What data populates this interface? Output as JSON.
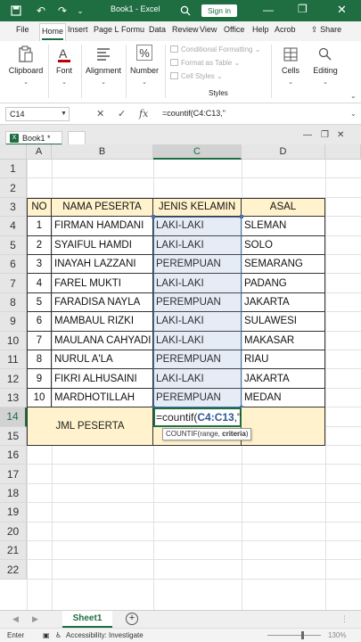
{
  "titlebar": {
    "title": "Book1 - Excel",
    "signin": "Sign in",
    "icons": [
      "save-icon",
      "undo-icon",
      "redo-icon",
      "customize-arrow-icon",
      "search-icon",
      "minimize-icon",
      "restore-icon",
      "close-icon"
    ],
    "bg_color": "#1e6e42"
  },
  "tabs": {
    "items": [
      "File",
      "Home",
      "Insert",
      "Page L",
      "Formu",
      "Data",
      "Review",
      "View",
      "Office",
      "Help",
      "Acrob"
    ],
    "active": "Home",
    "share": "Share"
  },
  "ribbon": {
    "groups": [
      {
        "label": "Clipboard",
        "icon": "clipboard-icon"
      },
      {
        "label": "Font",
        "icon": "font-icon"
      },
      {
        "label": "Alignment",
        "icon": "alignment-icon"
      },
      {
        "label": "Number",
        "icon": "percent-icon"
      },
      {
        "label": "Cells",
        "icon": "cells-icon"
      },
      {
        "label": "Editing",
        "icon": "editing-icon"
      }
    ],
    "styles": {
      "conditional": "Conditional Formatting",
      "table": "Format as Table",
      "cell": "Cell Styles",
      "label": "Styles"
    }
  },
  "formula_bar": {
    "name_box": "C14",
    "formula": "=countif(C4:C13,\""
  },
  "workbook_tab": {
    "name": "Book1 *"
  },
  "grid": {
    "columns": [
      "A",
      "B",
      "C",
      "D"
    ],
    "rows": [
      "1",
      "2",
      "3",
      "4",
      "5",
      "6",
      "7",
      "8",
      "9",
      "10",
      "11",
      "12",
      "13",
      "14",
      "15",
      "16",
      "17",
      "18",
      "19",
      "20",
      "21",
      "22"
    ],
    "header": {
      "no": "NO",
      "nama": "NAMA PESERTA",
      "jenis": "JENIS KELAMIN",
      "asal": "ASAL"
    },
    "records": [
      {
        "no": "1",
        "nama": "FIRMAN HAMDANI",
        "jenis": "LAKI-LAKI",
        "asal": "SLEMAN"
      },
      {
        "no": "2",
        "nama": "SYAIFUL HAMDI",
        "jenis": "LAKI-LAKI",
        "asal": "SOLO"
      },
      {
        "no": "3",
        "nama": "INAYAH LAZZANI",
        "jenis": "PEREMPUAN",
        "asal": "SEMARANG"
      },
      {
        "no": "4",
        "nama": "FAREL MUKTI",
        "jenis": "LAKI-LAKI",
        "asal": "PADANG"
      },
      {
        "no": "5",
        "nama": "FARADISA NAYLA",
        "jenis": "PEREMPUAN",
        "asal": "JAKARTA"
      },
      {
        "no": "6",
        "nama": "MAMBAUL RIZKI",
        "jenis": "LAKI-LAKI",
        "asal": "SULAWESI"
      },
      {
        "no": "7",
        "nama": "MAULANA CAHYADI",
        "jenis": "LAKI-LAKI",
        "asal": "MAKASAR"
      },
      {
        "no": "8",
        "nama": "NURUL A'LA",
        "jenis": "PEREMPUAN",
        "asal": "RIAU"
      },
      {
        "no": "9",
        "nama": "FIKRI ALHUSAINI",
        "jenis": "LAKI-LAKI",
        "asal": "JAKARTA"
      },
      {
        "no": "10",
        "nama": "MARDHOTILLAH",
        "jenis": "PEREMPUAN",
        "asal": "MEDAN"
      }
    ],
    "summary_label": "JML PESERTA",
    "active_cell": {
      "prefix": "=countif(",
      "ref": "C4:C13",
      "suffix": ",\""
    },
    "tooltip": {
      "fn": "COUNTIF(",
      "arg1": "range, ",
      "arg2": "criteria",
      "close": ")"
    },
    "header_fill": "#fff2cc"
  },
  "sheets": {
    "active": "Sheet1"
  },
  "status": {
    "mode": "Enter",
    "accessibility": "Accessibility: Investigate",
    "zoom": "130%"
  }
}
